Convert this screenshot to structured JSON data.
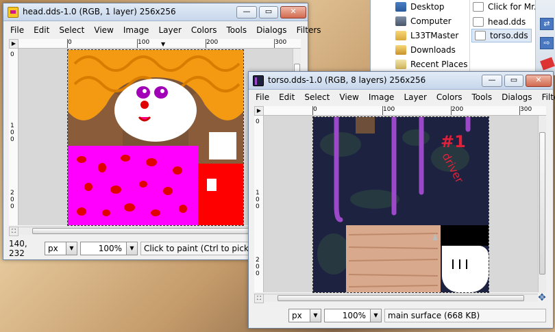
{
  "explorer": {
    "nav_items": [
      {
        "label": "Desktop",
        "icon": "desktop-icon"
      },
      {
        "label": "Computer",
        "icon": "computer-icon"
      },
      {
        "label": "L33TMaster",
        "icon": "user-folder-icon"
      },
      {
        "label": "Downloads",
        "icon": "downloads-folder-icon"
      },
      {
        "label": "Recent Places",
        "icon": "recent-places-icon"
      }
    ],
    "files": [
      {
        "label": "Click for Mr.",
        "icon": "document-icon"
      },
      {
        "label": "head.dds",
        "icon": "image-file-icon"
      },
      {
        "label": "torso.dds",
        "icon": "image-file-icon"
      }
    ]
  },
  "head_window": {
    "title": "head.dds-1.0 (RGB, 1 layer) 256x256",
    "menu": [
      "File",
      "Edit",
      "Select",
      "View",
      "Image",
      "Layer",
      "Colors",
      "Tools",
      "Dialogs",
      "Filters"
    ],
    "ruler_h": [
      "0",
      "100",
      "200",
      "300"
    ],
    "ruler_v": [
      "0",
      "100",
      "200"
    ],
    "status": {
      "coords": "140, 232",
      "unit": "px",
      "zoom": "100%",
      "message": "Click to paint (Ctrl to pick a co"
    }
  },
  "torso_window": {
    "title": "torso.dds-1.0 (RGB, 8 layers) 256x256",
    "menu": [
      "File",
      "Edit",
      "Select",
      "View",
      "Image",
      "Layer",
      "Colors",
      "Tools",
      "Dialogs",
      "Filters"
    ],
    "ruler_h": [
      "0",
      "100",
      "200",
      "300"
    ],
    "ruler_v": [
      "0",
      "100",
      "200"
    ],
    "canvas_text": {
      "number": "#1",
      "word": "driver"
    },
    "status": {
      "unit": "px",
      "zoom": "100%",
      "message": "main surface (668 KB)"
    }
  },
  "colors": {
    "titlebar": "#c6d6eb",
    "hair": "#f39a12",
    "magenta": "#ff00ff",
    "red": "#ff0000",
    "shirt": "#1d2240",
    "stripe": "#9b49c9"
  }
}
